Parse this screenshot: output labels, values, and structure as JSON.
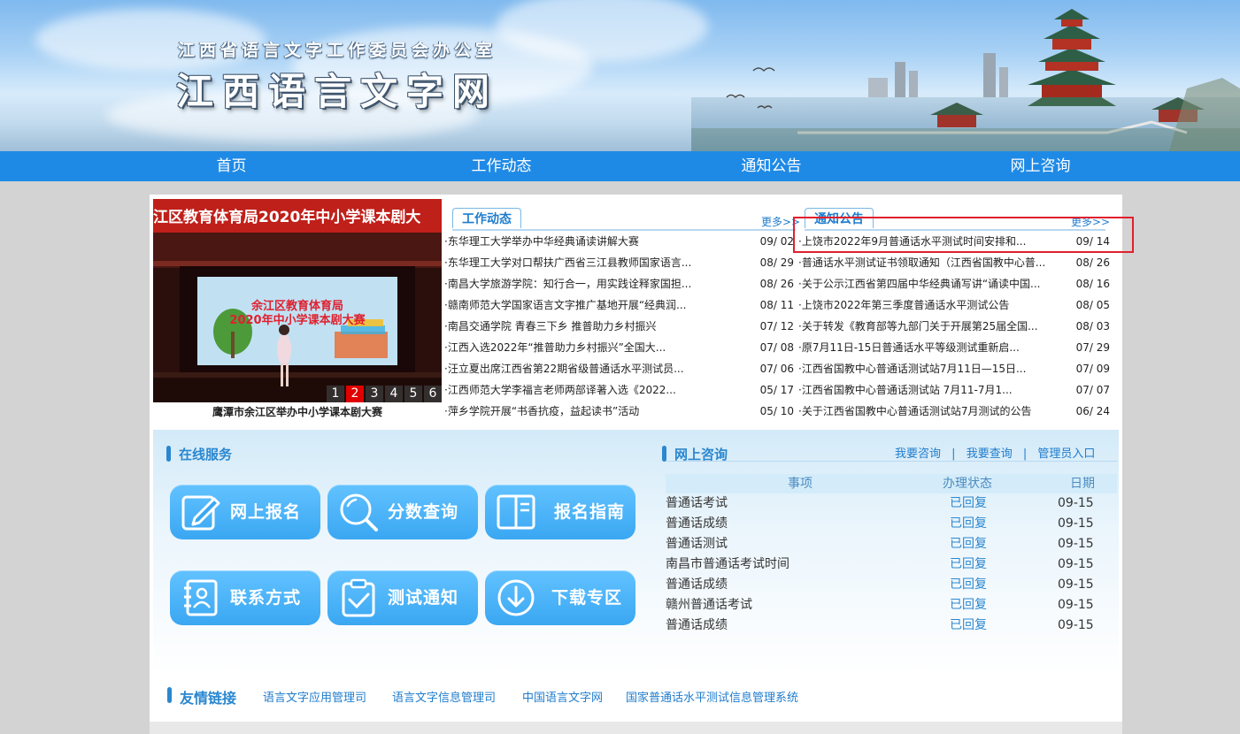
{
  "header": {
    "subtitle": "江西省语言文字工作委员会办公室",
    "title": "江西语言文字网"
  },
  "nav": [
    {
      "label": "首页"
    },
    {
      "label": "工作动态"
    },
    {
      "label": "通知公告"
    },
    {
      "label": "网上咨询"
    }
  ],
  "slideshow": {
    "banner_text": "江区教育体育局2020年中小学课本剧大",
    "screen_line1": "余江区教育体育局",
    "screen_line2": "2020年中小学课本剧大赛",
    "caption": "鹰潭市余江区举办中小学课本剧大赛",
    "pages": [
      "1",
      "2",
      "3",
      "4",
      "5",
      "6"
    ],
    "active_page": "2"
  },
  "work_news": {
    "tab": "工作动态",
    "more": "更多>>",
    "items": [
      {
        "title": "·东华理工大学举办中华经典诵读讲解大赛",
        "date": "09/ 02"
      },
      {
        "title": "·东华理工大学对口帮扶广西省三江县教师国家语言...",
        "date": "08/ 29"
      },
      {
        "title": "·南昌大学旅游学院：知行合一，用实践诠释家国担...",
        "date": "08/ 26"
      },
      {
        "title": "·赣南师范大学国家语言文字推广基地开展“经典润...",
        "date": "08/ 11"
      },
      {
        "title": "·南昌交通学院 青春三下乡 推普助力乡村振兴",
        "date": "07/ 12"
      },
      {
        "title": "·江西入选2022年“推普助力乡村振兴”全国大...",
        "date": "07/ 08"
      },
      {
        "title": "·汪立夏出席江西省第22期省级普通话水平测试员...",
        "date": "07/ 06"
      },
      {
        "title": "·江西师范大学李福言老师两部译著入选《2022...",
        "date": "05/ 17"
      },
      {
        "title": "·萍乡学院开展“书香抗疫，益起读书”活动",
        "date": "05/ 10"
      }
    ]
  },
  "notices": {
    "tab": "通知公告",
    "more": "更多>>",
    "items": [
      {
        "title": "·上饶市2022年9月普通话水平测试时间安排和...",
        "date": "09/ 14"
      },
      {
        "title": "·普通话水平测试证书领取通知（江西省国教中心普...",
        "date": "08/ 26"
      },
      {
        "title": "·关于公示江西省第四届中华经典诵写讲“诵读中国...",
        "date": "08/ 16"
      },
      {
        "title": "·上饶市2022年第三季度普通话水平测试公告",
        "date": "08/ 05"
      },
      {
        "title": "·关于转发《教育部等九部门关于开展第25届全国...",
        "date": "08/ 03"
      },
      {
        "title": "·原7月11日-15日普通话水平等级测试重新启...",
        "date": "07/ 29"
      },
      {
        "title": "·江西省国教中心普通话测试站7月11日—15日...",
        "date": "07/ 09"
      },
      {
        "title": "·江西省国教中心普通话测试站 7月11-7月1...",
        "date": "07/ 07"
      },
      {
        "title": "·关于江西省国教中心普通话测试站7月测试的公告",
        "date": "06/ 24"
      }
    ]
  },
  "services": {
    "title": "在线服务",
    "buttons": [
      {
        "label": "网上报名",
        "icon": "pencil-icon"
      },
      {
        "label": "分数查询",
        "icon": "magnifier-icon"
      },
      {
        "label": "报名指南",
        "icon": "book-icon"
      },
      {
        "label": "联系方式",
        "icon": "contact-book-icon"
      },
      {
        "label": "测试通知",
        "icon": "clipboard-check-icon"
      },
      {
        "label": "下载专区",
        "icon": "download-icon"
      }
    ]
  },
  "consult": {
    "title": "网上咨询",
    "links": [
      "我要咨询",
      "我要查询",
      "管理员入口"
    ],
    "separator": "|",
    "columns": [
      "事项",
      "办理状态",
      "日期"
    ],
    "rows": [
      {
        "item": "普通话考试",
        "status": "已回复",
        "date": "09-15"
      },
      {
        "item": "普通话成绩",
        "status": "已回复",
        "date": "09-15"
      },
      {
        "item": "普通话测试",
        "status": "已回复",
        "date": "09-15"
      },
      {
        "item": "南昌市普通话考试时间",
        "status": "已回复",
        "date": "09-15"
      },
      {
        "item": "普通话成绩",
        "status": "已回复",
        "date": "09-15"
      },
      {
        "item": "赣州普通话考试",
        "status": "已回复",
        "date": "09-15"
      },
      {
        "item": "普通话成绩",
        "status": "已回复",
        "date": "09-15"
      }
    ]
  },
  "friend_links": {
    "title": "友情链接",
    "items": [
      "语言文字应用管理司",
      "语言文字信息管理司",
      "中国语言文字网",
      "国家普通话水平测试信息管理系统"
    ]
  },
  "colors": {
    "nav": "#1f8ae6",
    "accent": "#2a87cf",
    "highlight_box": "#e0202e",
    "pager_active": "#e00000"
  }
}
